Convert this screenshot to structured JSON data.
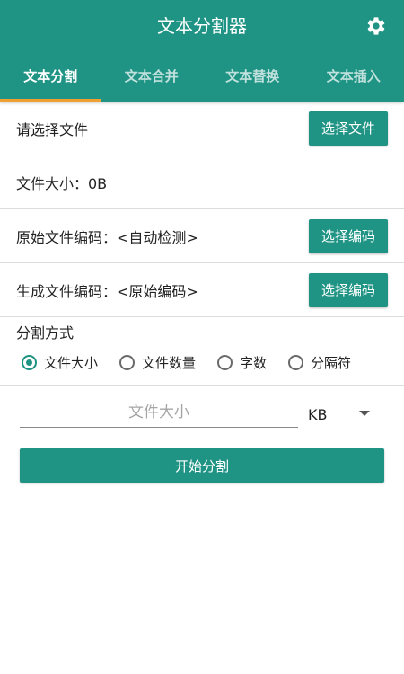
{
  "app": {
    "title": "文本分割器",
    "settings_icon": "gear-icon",
    "accent_color": "#1f9484",
    "tab_indicator_color": "#f0a030"
  },
  "tabs": [
    {
      "label": "文本分割",
      "active": true
    },
    {
      "label": "文本合并",
      "active": false
    },
    {
      "label": "文本替换",
      "active": false
    },
    {
      "label": "文本插入",
      "active": false
    }
  ],
  "file": {
    "label": "请选择文件",
    "button": "选择文件"
  },
  "size": {
    "label": "文件大小：0B"
  },
  "source_encoding": {
    "label": "原始文件编码：<自动检测>",
    "button": "选择编码"
  },
  "output_encoding": {
    "label": "生成文件编码：<原始编码>",
    "button": "选择编码"
  },
  "split": {
    "title": "分割方式",
    "options": [
      {
        "label": "文件大小",
        "checked": true
      },
      {
        "label": "文件数量",
        "checked": false
      },
      {
        "label": "字数",
        "checked": false
      },
      {
        "label": "分隔符",
        "checked": false
      }
    ],
    "input_placeholder": "文件大小",
    "input_value": "",
    "unit": "KB"
  },
  "start_button": "开始分割"
}
